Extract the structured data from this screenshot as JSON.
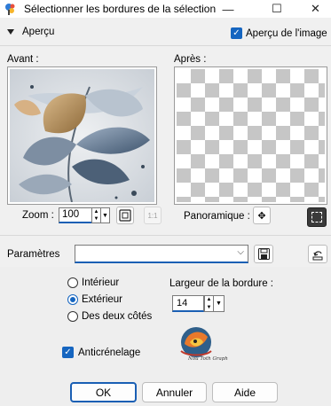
{
  "window": {
    "title": "Sélectionner les bordures de la sélection",
    "min_glyph": "—",
    "max_glyph": "☐",
    "close_glyph": "✕"
  },
  "preview": {
    "section_label": "Aperçu",
    "show_image_label": "Aperçu de l'image",
    "show_image_checked": true,
    "before_label": "Avant :",
    "after_label": "Après :"
  },
  "zoom": {
    "label": "Zoom :",
    "value": "100",
    "pan_label": "Panoramique :",
    "actual_size_glyph": "1:1"
  },
  "params": {
    "label": "Paramètres",
    "preset_value": ""
  },
  "options": {
    "inside_label": "Intérieur",
    "outside_label": "Extérieur",
    "both_label": "Des deux côtés",
    "selected": "outside",
    "border_width_label": "Largeur de la bordure :",
    "border_width_value": "14",
    "antialias_label": "Anticrénelage",
    "antialias_checked": true
  },
  "logo_text": "Nou Toth Graph",
  "buttons": {
    "ok": "OK",
    "cancel": "Annuler",
    "help": "Aide"
  },
  "colors": {
    "accent": "#1565c0",
    "focus_border": "#1a5fb4",
    "checker": "#c6c6c6"
  }
}
